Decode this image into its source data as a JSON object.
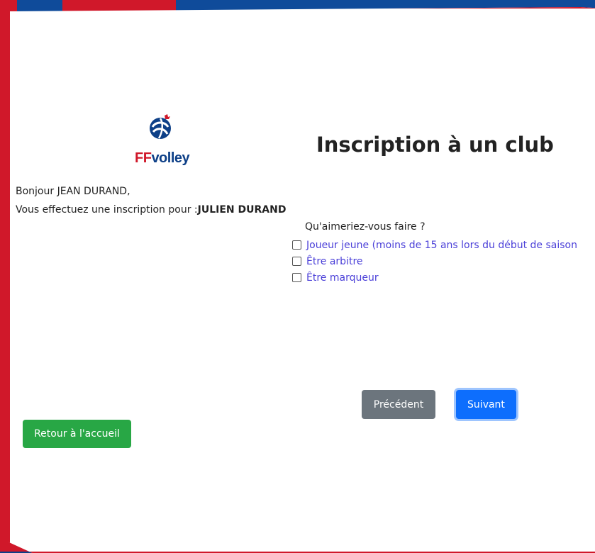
{
  "header": {
    "logo_ff": "FF",
    "logo_volley": "volley",
    "title": "Inscription à un club"
  },
  "greeting": "Bonjour JEAN DURAND,",
  "registration": {
    "prefix": "Vous effectuez une inscription pour :",
    "name": "JULIEN DURAND"
  },
  "question": "Qu'aimeriez-vous faire ?",
  "options": [
    {
      "label": "Joueur jeune (moins de 15 ans lors du début de saison",
      "checked": false
    },
    {
      "label": "Être arbitre",
      "checked": false
    },
    {
      "label": "Être marqueur",
      "checked": false
    }
  ],
  "buttons": {
    "previous": "Précédent",
    "next": "Suivant",
    "home": "Retour à l'accueil"
  },
  "colors": {
    "brand_red": "#d0182a",
    "brand_blue": "#0d3f87",
    "link_purple": "#4a3fd8",
    "btn_secondary": "#6c757d",
    "btn_primary": "#0d6efd",
    "btn_success": "#28a745"
  },
  "icons": {
    "logo": "ffvolley-rooster-logo",
    "checkbox": "checkbox-unchecked"
  }
}
